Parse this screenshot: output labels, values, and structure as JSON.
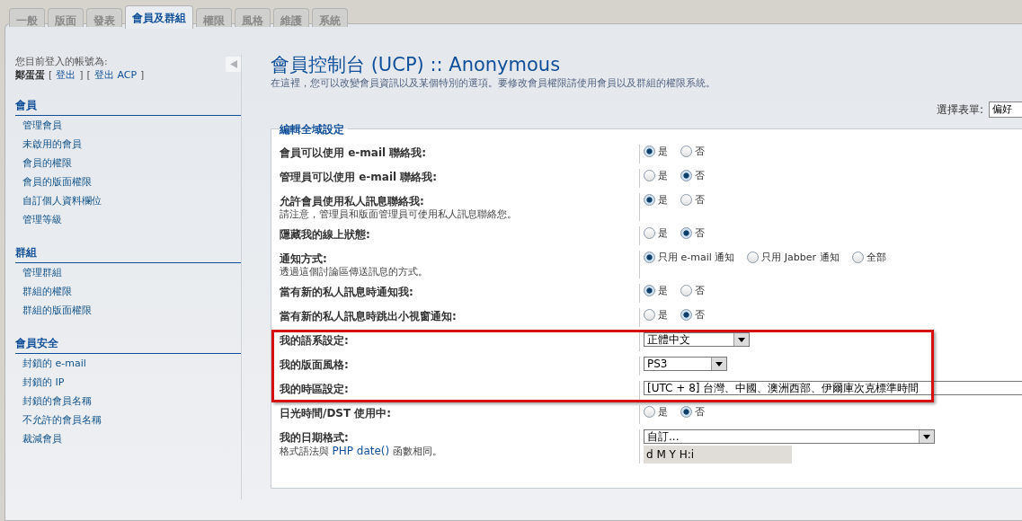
{
  "tabs": [
    {
      "label": "一般",
      "selected": false
    },
    {
      "label": "版面",
      "selected": false
    },
    {
      "label": "發表",
      "selected": false
    },
    {
      "label": "會員及群組",
      "selected": true
    },
    {
      "label": "權限",
      "selected": false
    },
    {
      "label": "風格",
      "selected": false
    },
    {
      "label": "維護",
      "selected": false
    },
    {
      "label": "系統",
      "selected": false
    }
  ],
  "sidebar": {
    "login_label": "您目前登入的帳號為:",
    "username": "鄭蛋蛋",
    "links": [
      {
        "before": "[",
        "label": "登出",
        "after": "]"
      },
      {
        "before": "[",
        "label": "登出 ACP",
        "after": "]"
      }
    ],
    "sections": [
      {
        "title": "會員",
        "items": [
          "管理會員",
          "未啟用的會員",
          "會員的權限",
          "會員的版面權限",
          "自訂個人資料欄位",
          "管理等級"
        ]
      },
      {
        "title": "群組",
        "items": [
          "管理群組",
          "群組的權限",
          "群組的版面權限"
        ]
      },
      {
        "title": "會員安全",
        "items": [
          "封鎖的 e-mail",
          "封鎖的 IP",
          "封鎖的會員名稱",
          "不允許的會員名稱",
          "裁減會員"
        ]
      }
    ]
  },
  "main": {
    "title": "會員控制台 (UCP) :: Anonymous",
    "description": "在這裡，您可以改變會員資訊以及某個特別的選項。要修改會員權限請使用會員以及群組的權限系統。",
    "form_select": {
      "label": "選擇表單:",
      "value": "偏好"
    },
    "fieldset": {
      "legend": "編輯全域設定",
      "rows": [
        {
          "label": "會員可以使用 e-mail 聯絡我:",
          "kind": "radio",
          "highlighted": false,
          "options": [
            {
              "label": "是",
              "selected": true
            },
            {
              "label": "否",
              "selected": false
            }
          ]
        },
        {
          "label": "管理員可以使用 e-mail 聯絡我:",
          "kind": "radio",
          "highlighted": false,
          "options": [
            {
              "label": "是",
              "selected": false
            },
            {
              "label": "否",
              "selected": true
            }
          ]
        },
        {
          "label": "允許會員使用私人訊息聯絡我:",
          "explain": "請注意，管理員和版面管理員可使用私人訊息聯絡您。",
          "kind": "radio",
          "highlighted": false,
          "options": [
            {
              "label": "是",
              "selected": true
            },
            {
              "label": "否",
              "selected": false
            }
          ]
        },
        {
          "label": "隱藏我的線上狀態:",
          "kind": "radio",
          "highlighted": false,
          "options": [
            {
              "label": "是",
              "selected": false
            },
            {
              "label": "否",
              "selected": true
            }
          ]
        },
        {
          "label": "通知方式:",
          "explain": "透過這個討論區傳送訊息的方式。",
          "kind": "radio",
          "highlighted": false,
          "options": [
            {
              "label": "只用 e-mail 通知",
              "selected": true
            },
            {
              "label": "只用 Jabber 通知",
              "selected": false
            },
            {
              "label": "全部",
              "selected": false
            }
          ]
        },
        {
          "label": "當有新的私人訊息時通知我:",
          "kind": "radio",
          "highlighted": false,
          "options": [
            {
              "label": "是",
              "selected": true
            },
            {
              "label": "否",
              "selected": false
            }
          ]
        },
        {
          "label": "當有新的私人訊息時跳出小視窗通知:",
          "kind": "radio",
          "highlighted": false,
          "options": [
            {
              "label": "是",
              "selected": false
            },
            {
              "label": "否",
              "selected": true
            }
          ]
        },
        {
          "label": "我的語系設定:",
          "kind": "select",
          "highlighted": true,
          "value": "正體中文"
        },
        {
          "label": "我的版面風格:",
          "kind": "select",
          "highlighted": true,
          "value": "PS3"
        },
        {
          "label": "我的時區設定:",
          "kind": "select_wide",
          "highlighted": true,
          "value": "[UTC + 8] 台灣、中國、澳洲西部、伊爾庫次克標準時間"
        },
        {
          "label": "日光時間/DST 使用中:",
          "kind": "radio",
          "highlighted": false,
          "options": [
            {
              "label": "是",
              "selected": false
            },
            {
              "label": "否",
              "selected": true
            }
          ]
        },
        {
          "label": "我的日期格式:",
          "explain_parts": {
            "before": "格式語法與 ",
            "link": "PHP date()",
            "after": " 函數相同。"
          },
          "kind": "dateformat",
          "highlighted": false,
          "value": "自訂...",
          "input_value": "d M Y H:i"
        }
      ]
    }
  }
}
